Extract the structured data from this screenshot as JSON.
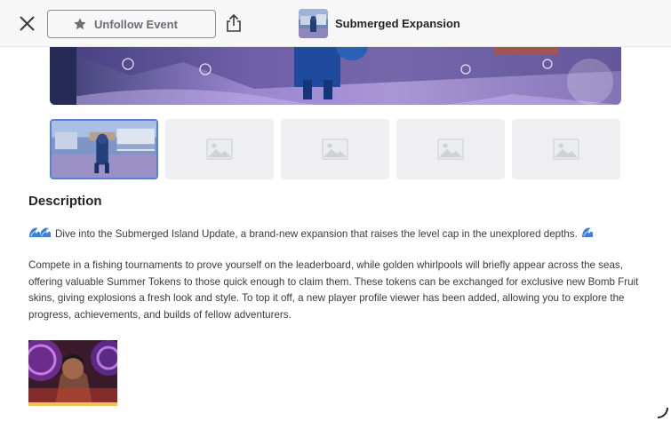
{
  "topbar": {
    "unfollow_label": "Unfollow Event",
    "event_title": "Submerged Expansion"
  },
  "gallery": {
    "selected_index": 0,
    "thumb_count": 5
  },
  "description": {
    "heading": "Description",
    "intro": "Dive into the Submerged Island Update, a brand-new expansion that raises the level cap in the unexplored depths.",
    "body": "Compete in a fishing tournaments to prove yourself on the leaderboard, while golden whirlpools will briefly appear across the seas, offering valuable Summer Tokens to those quick enough to claim them. These tokens can be exchanged for exclusive new Bomb Fruit skins, giving explosions a fresh look and style. To top it off, a new player profile viewer has been added, allowing you to explore the progress, achievements, and builds of fellow adventurers."
  },
  "colors": {
    "accent": "#5b7ed6",
    "topbar_bg": "#f7f7f8",
    "placeholder_bg": "#efeff1"
  },
  "icons": {
    "close": "close-icon",
    "star": "star-icon",
    "share": "share-icon",
    "image_placeholder": "image-placeholder-icon",
    "wave": "wave-emoji-icon"
  }
}
